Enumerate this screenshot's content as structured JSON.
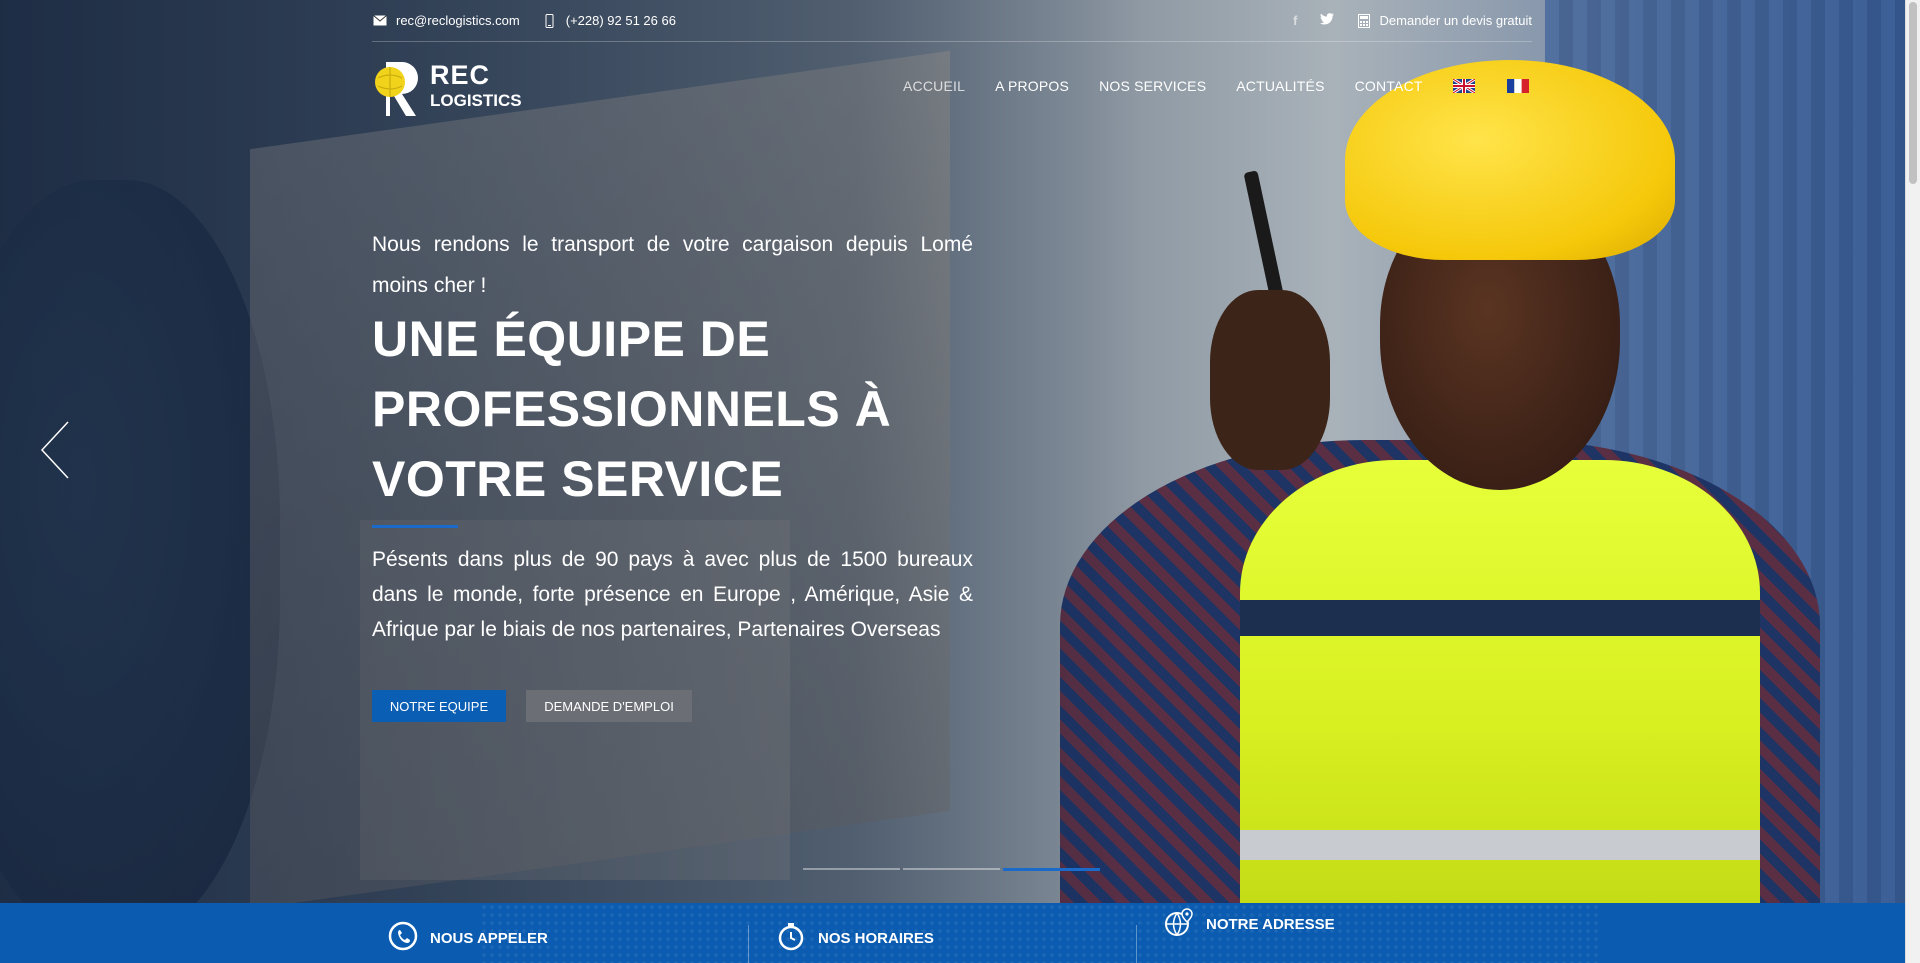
{
  "topbar": {
    "email": "rec@reclogistics.com",
    "phone": "(+228) 92 51 26 66",
    "facebook_icon": "f",
    "quote_label": "Demander un devis gratuit"
  },
  "logo": {
    "line1": "REC",
    "line2": "LOGISTICS"
  },
  "nav": {
    "items": [
      "ACCUEIL",
      "A PROPOS",
      "NOS SERVICES",
      "ACTUALITÉS",
      "CONTACT"
    ],
    "flags": [
      "english-flag",
      "french-flag"
    ]
  },
  "hero": {
    "tagline": "Nous rendons le transport de votre cargaison depuis Lomé moins cher !",
    "headline": "UNE ÉQUIPE DE PROFESSIONNELS À VOTRE SERVICE",
    "description": "Pésents dans plus de 90 pays à avec plus de 1500 bureaux dans le monde, forte présence en Europe , Amérique, Asie & Afrique par le biais de nos partenaires, Partenaires Overseas",
    "button_primary": "NOTRE EQUIPE",
    "button_secondary": "DEMANDE D'EMPLOI",
    "slides_count": 3,
    "active_slide": 3
  },
  "band": {
    "items": [
      {
        "label": "NOUS APPELER",
        "icon": "phone-icon"
      },
      {
        "label": "NOS HORAIRES",
        "icon": "clock-icon"
      },
      {
        "label": "NOTRE ADRESSE",
        "icon": "globe-pin-icon"
      }
    ]
  },
  "colors": {
    "accent": "#0b5cb0",
    "secondary_button": "#6b6f75",
    "helmet": "#f5c80a"
  }
}
